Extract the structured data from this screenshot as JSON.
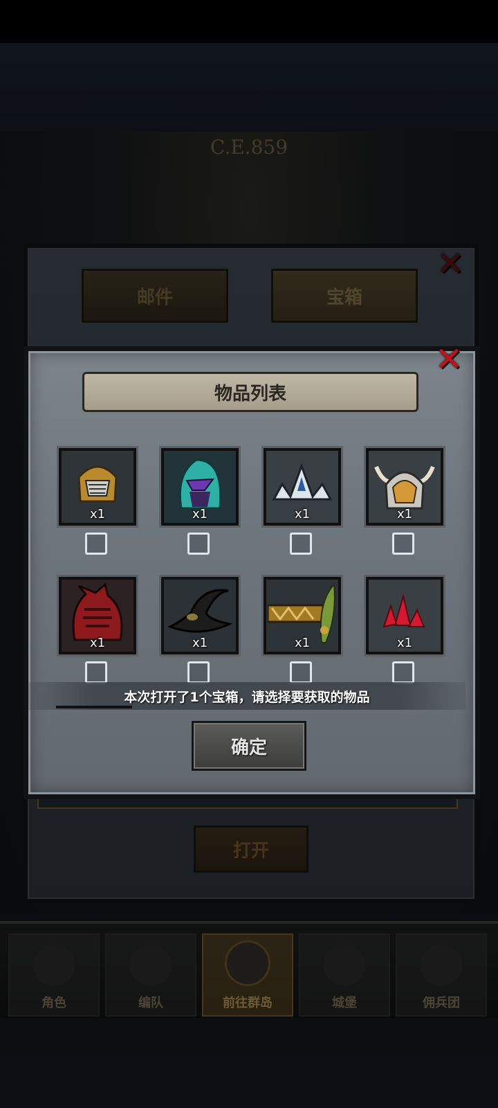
{
  "background": {
    "era_title": "C.E.859",
    "colors": {
      "accent_gold": "#c0a060",
      "close_red": "#c3121a"
    }
  },
  "mail_panel": {
    "tabs": [
      {
        "label": "邮件"
      },
      {
        "label": "宝箱"
      }
    ],
    "active_tab": "宝箱",
    "open_button": "打开"
  },
  "dialog": {
    "title": "物品列表",
    "items": [
      {
        "name_icon": "gold-knight-helmet-icon",
        "qty": "x1"
      },
      {
        "name_icon": "teal-flame-helmet-icon",
        "qty": "x1"
      },
      {
        "name_icon": "silver-crown-icon",
        "qty": "x1"
      },
      {
        "name_icon": "horned-gold-helmet-icon",
        "qty": "x1"
      },
      {
        "name_icon": "red-spiked-helmet-icon",
        "qty": "x1"
      },
      {
        "name_icon": "black-wizard-hat-icon",
        "qty": "x1"
      },
      {
        "name_icon": "leaf-circlet-icon",
        "qty": "x1"
      },
      {
        "name_icon": "red-crystal-icon",
        "qty": "x1"
      }
    ],
    "prompt": "本次打开了1个宝箱，请选择要获取的物品",
    "confirm_button": "确定"
  },
  "bottom_nav": {
    "items": [
      {
        "label": "角色",
        "icon": "knight-icon"
      },
      {
        "label": "编队",
        "icon": "helmet-icon"
      },
      {
        "label": "前往群岛",
        "icon": "compass-icon"
      },
      {
        "label": "城堡",
        "icon": "castle-icon"
      },
      {
        "label": "佣兵团",
        "icon": "banner-icon"
      }
    ],
    "active": "前往群岛"
  }
}
